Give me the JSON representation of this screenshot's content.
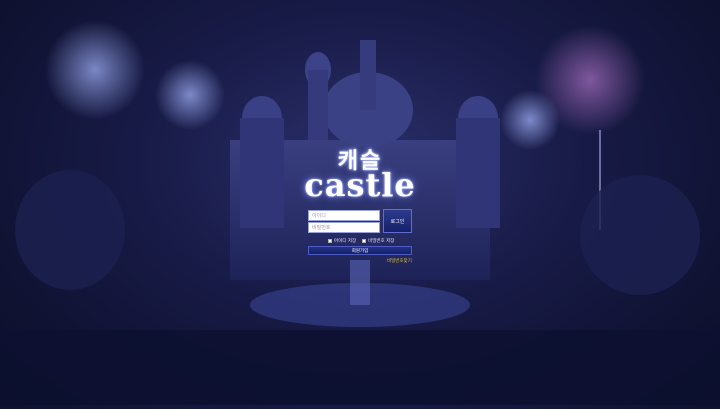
{
  "logo": {
    "korean": "캐슬",
    "english": "castle"
  },
  "login": {
    "id_placeholder": "아이디",
    "pw_placeholder": "비밀번호",
    "login_label": "로그인",
    "save_id_label": "아이디 저장",
    "save_pw_label": "비밀번호 저장",
    "signup_label": "회원가입",
    "find_pw_label": "비밀번호찾기"
  },
  "colors": {
    "accent": "#1c2a7a",
    "link": "#e0c24a"
  }
}
